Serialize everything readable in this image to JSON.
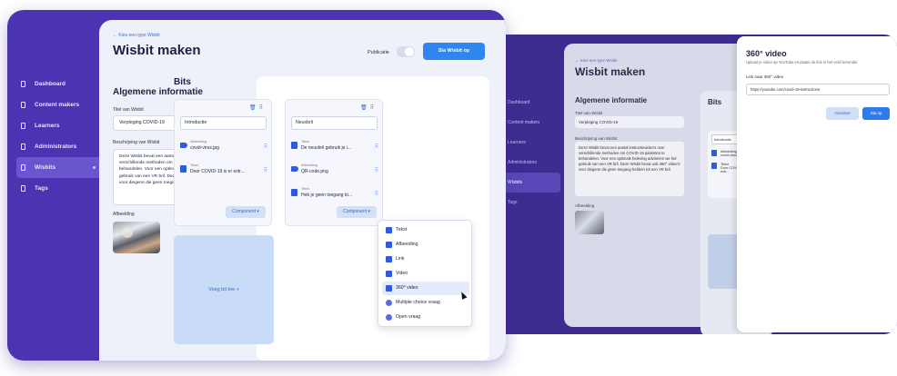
{
  "back_screen": {
    "nav": [
      "Dashboard",
      "Content makers",
      "Learners",
      "Administrators",
      "Wisbits",
      "Tags"
    ],
    "back_link": "← Kies een type Wisbit",
    "title": "Wisbit maken",
    "section": "Algemene informatie",
    "title_label": "Titel van Wisbit",
    "title_value": "Verpleging COVID-19",
    "desc_label": "Beschrijving van Wisbit",
    "desc_value": "Deze Wisbit bevat een aantal instructievideo's over verschillende methoden om COVID-19 patiënten te behandelen. Voor een optimale beleving adviseren we het gebruik van een VR bril. Deze Wisbit bevat ook 360° video's voor diegene die geen toegang hebben tot een VR bril.",
    "image_label": "Afbeelding",
    "bits_title": "Bits",
    "card_name": "Introductie",
    "card_item_type": "Afbeelding",
    "card_item_value": "covid-virus.jpg",
    "card_item2_type": "Tekst",
    "card_item2_value": "Door COVID-19 is er extr..."
  },
  "modal": {
    "title": "360° video",
    "subtitle": "Upload je video op YouTube en plaats de link in het veld hieronder",
    "link_label": "Link naar 360° video",
    "link_value": "https://youtube.com/covid-19-instructions",
    "cancel": "Annuleer",
    "ok": "Sla op"
  },
  "nav": [
    {
      "label": "Dashboard",
      "icon": "page-icon"
    },
    {
      "label": "Content makers",
      "icon": "page-icon"
    },
    {
      "label": "Learners",
      "icon": "page-icon"
    },
    {
      "label": "Administrators",
      "icon": "page-icon"
    },
    {
      "label": "Wisbits",
      "icon": "page-icon",
      "active": true
    },
    {
      "label": "Tags",
      "icon": "page-icon"
    }
  ],
  "header": {
    "back_link": "← Kies een type Wisbit",
    "title": "Wisbit maken",
    "publish_label": "Publicatie",
    "save_label": "Sla Wisbit op"
  },
  "general": {
    "section_title": "Algemene informatie",
    "title_label": "Titel van Wisbit",
    "title_value": "Verpleging COVID-19",
    "desc_label": "Beschrijving van Wisbit",
    "desc_value": "Deze Wisbit bevat een aantal instructievideo's over verschillende methoden om COVID-19 patiënten te behandelen. Voor een optimale beleving adviseren we het gebruik van een VR bril. Deze Wisbit bevat ook 360° video's voor diegene die geen toegang hebben tot een VR bril.",
    "image_label": "Afbeelding"
  },
  "bits": {
    "title": "Bits",
    "cards": [
      {
        "name": "Introductie",
        "items": [
          {
            "type": "Afbeelding",
            "value": "covid-virus.jpg"
          },
          {
            "type": "Tekst",
            "value": "Door COVID-19 is er extr..."
          }
        ],
        "component_label": "Component ▾"
      },
      {
        "name": "Neusbril",
        "items": [
          {
            "type": "Tekst",
            "value": "De neusbril gebruik je i..."
          },
          {
            "type": "Afbeelding",
            "value": "QR-code.png"
          },
          {
            "type": "Tekst",
            "value": "Heb je geen toegang to..."
          }
        ],
        "component_label": "Component ▾"
      }
    ],
    "add_bit_label": "Voeg bit toe +"
  },
  "component_menu": [
    "Tekst",
    "Afbeelding",
    "Link",
    "Video",
    "360° video",
    "Multiple choice vraag",
    "Open vraag"
  ],
  "colors": {
    "primary": "#2f86f0",
    "sidebar": "#4c33b2",
    "accent_blue": "#2f5bd9"
  }
}
